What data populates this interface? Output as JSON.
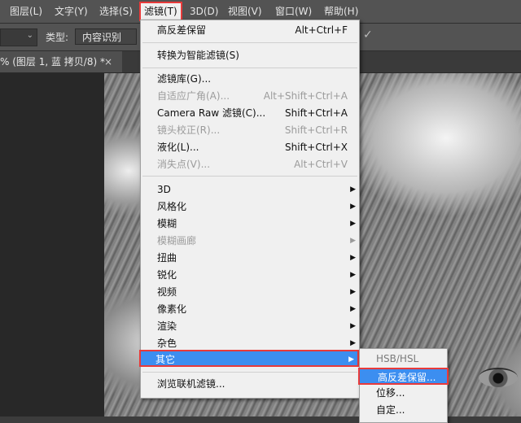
{
  "menubar": {
    "items": [
      "图层(L)",
      "文字(Y)",
      "选择(S)",
      "滤镜(T)",
      "3D(D)",
      "视图(V)",
      "窗口(W)",
      "帮助(H)"
    ],
    "active_index": 3
  },
  "options": {
    "type_label": "类型:",
    "type_value": "内容识别"
  },
  "tab": {
    "title": "% (图层 1, 蓝 拷贝/8) *",
    "close": "×"
  },
  "filter_menu": {
    "items": [
      {
        "label": "高反差保留",
        "shortcut": "Alt+Ctrl+F",
        "enabled": true
      },
      {
        "label": "转换为智能滤镜(S)",
        "shortcut": "",
        "enabled": true
      },
      {
        "label": "滤镜库(G)...",
        "shortcut": "",
        "enabled": true
      },
      {
        "label": "自适应广角(A)...",
        "shortcut": "Alt+Shift+Ctrl+A",
        "enabled": false
      },
      {
        "label": "Camera Raw 滤镜(C)...",
        "shortcut": "Shift+Ctrl+A",
        "enabled": true
      },
      {
        "label": "镜头校正(R)...",
        "shortcut": "Shift+Ctrl+R",
        "enabled": false
      },
      {
        "label": "液化(L)...",
        "shortcut": "Shift+Ctrl+X",
        "enabled": true
      },
      {
        "label": "消失点(V)...",
        "shortcut": "Alt+Ctrl+V",
        "enabled": false
      },
      {
        "label": "3D",
        "submenu": true,
        "enabled": true
      },
      {
        "label": "风格化",
        "submenu": true,
        "enabled": true
      },
      {
        "label": "模糊",
        "submenu": true,
        "enabled": true
      },
      {
        "label": "模糊画廊",
        "submenu": true,
        "enabled": false
      },
      {
        "label": "扭曲",
        "submenu": true,
        "enabled": true
      },
      {
        "label": "锐化",
        "submenu": true,
        "enabled": true
      },
      {
        "label": "视频",
        "submenu": true,
        "enabled": true
      },
      {
        "label": "像素化",
        "submenu": true,
        "enabled": true
      },
      {
        "label": "渲染",
        "submenu": true,
        "enabled": true
      },
      {
        "label": "杂色",
        "submenu": true,
        "enabled": true
      },
      {
        "label": "其它",
        "submenu": true,
        "enabled": true,
        "highlighted": true
      },
      {
        "label": "浏览联机滤镜...",
        "shortcut": "",
        "enabled": true
      }
    ]
  },
  "other_submenu": {
    "items": [
      {
        "label": "HSB/HSL",
        "highlighted": false
      },
      {
        "label": "高反差保留...",
        "highlighted": true
      },
      {
        "label": "位移...",
        "highlighted": false
      },
      {
        "label": "自定...",
        "highlighted": false
      }
    ]
  },
  "colors": {
    "highlight": "#3c8ef0",
    "callout_border": "#e83a3a",
    "menu_bg": "#f0f0f0",
    "chrome_bg": "#535353"
  }
}
